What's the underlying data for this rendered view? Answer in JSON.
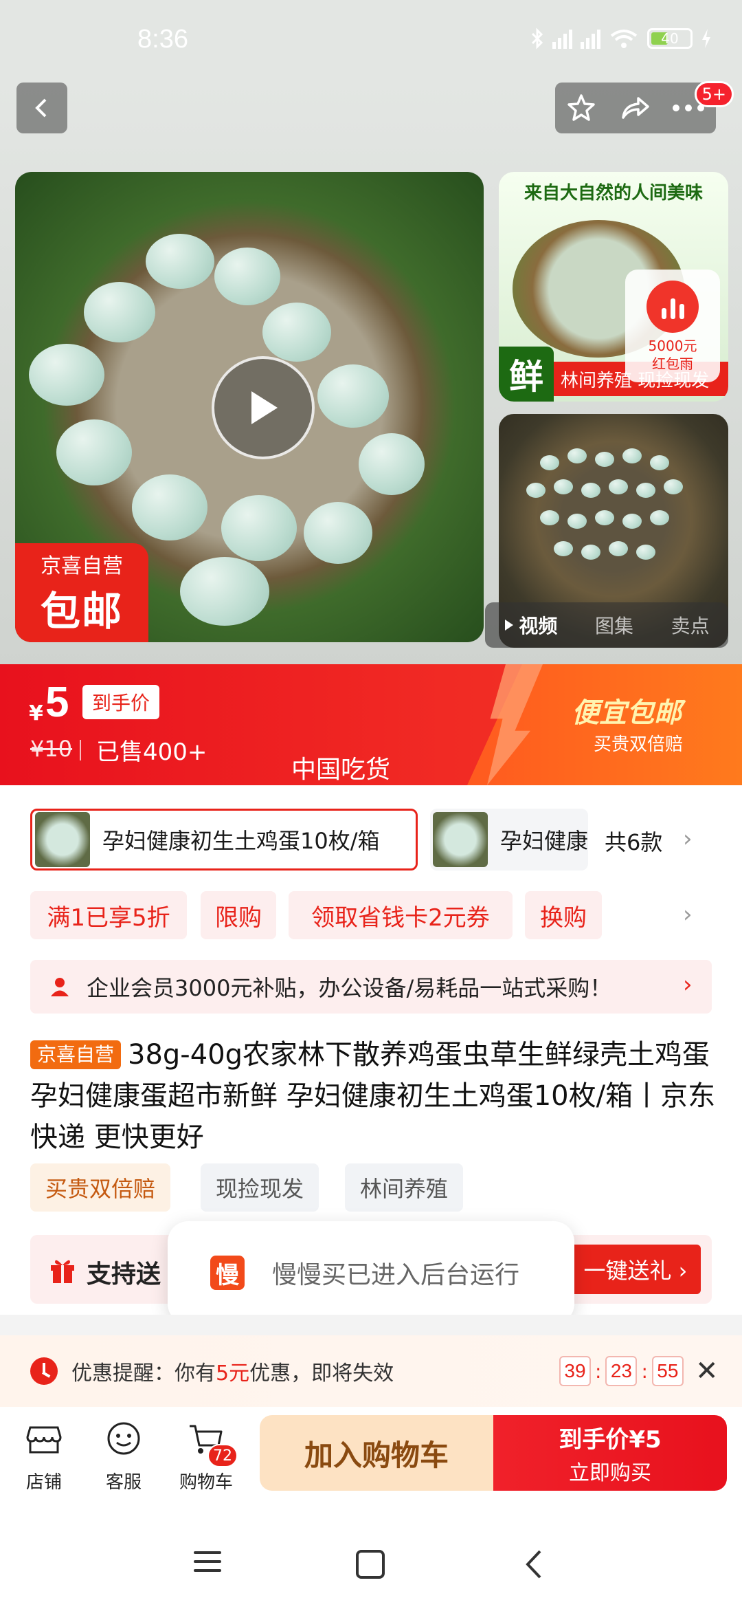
{
  "status_bar": {
    "time": "8:36",
    "battery": "40"
  },
  "header": {
    "notif_badge": "5+"
  },
  "gallery": {
    "main_badge_line1": "京喜自营",
    "main_badge_line2": "包邮",
    "thumb1_headline": "来自大自然的人间美味",
    "thumb1_fresh": "鲜",
    "thumb1_strip": "林间养殖 现捡现发",
    "redpack_amount": "5000元",
    "redpack_label": "红包雨",
    "tabs": [
      "视频",
      "图集",
      "卖点"
    ]
  },
  "price": {
    "symbol": "¥",
    "value": "5",
    "tag": "到手价",
    "old": "¥10",
    "sold": "已售400+",
    "watermark": "中国吃货",
    "promo_title": "便宜包邮",
    "promo_sub": "买贵双倍赔"
  },
  "sku": {
    "active_label": "孕妇健康初生土鸡蛋10枚/箱",
    "inactive_label": "孕妇健康",
    "count": "共6款"
  },
  "coupons": [
    "满1已享5折",
    "限购",
    "领取省钱卡2元券",
    "换购"
  ],
  "biz_bar": {
    "text": "企业会员3000元补贴，办公设备/易耗品一站式采购！"
  },
  "product": {
    "tag": "京喜自营",
    "title": "38g-40g农家林下散养鸡蛋虫草生鲜绿壳土鸡蛋孕妇健康蛋超市新鲜 孕妇健康初生土鸡蛋10枚/箱丨京东快递 更快更好"
  },
  "service_tags": [
    "买贵双倍赔",
    "现捡现发",
    "林间养殖"
  ],
  "gift": {
    "text": "支持送",
    "button": "一键送礼 ›"
  },
  "toast": {
    "icon": "慢",
    "message": "慢慢买已进入后台运行"
  },
  "reminder": {
    "prefix": "优惠提醒：你有",
    "amount": "5元",
    "suffix": "优惠，即将失效",
    "hours": "39",
    "minutes": "23",
    "seconds": "55"
  },
  "actions": {
    "shop": "店铺",
    "service": "客服",
    "cart": "购物车",
    "cart_count": "72",
    "add_to_cart": "加入购物车",
    "buy_line1": "到手价¥5",
    "buy_line2": "立即购买"
  }
}
